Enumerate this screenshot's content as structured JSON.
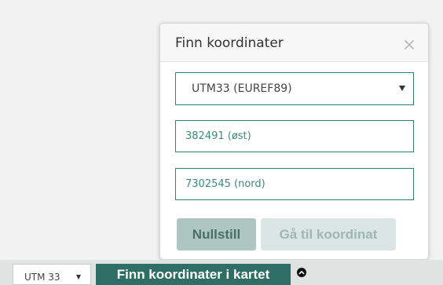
{
  "dialog": {
    "title": "Finn koordinater",
    "close_icon": "close-icon",
    "projection_select": {
      "selected": "UTM33 (EUREF89)"
    },
    "east_input": {
      "value": "",
      "placeholder": "382491 (øst)"
    },
    "north_input": {
      "value": "",
      "placeholder": "7302545 (nord)"
    },
    "reset_label": "Nullstill",
    "goto_label": "Gå til koordinat"
  },
  "bottom_bar": {
    "zone_select": {
      "selected": "UTM 33"
    },
    "find_label": "Finn koordinater i kartet",
    "collapse_icon": "chevron-up-circle-icon"
  },
  "colors": {
    "accent": "#2e6e64",
    "border_accent": "#3c7f71",
    "input_text": "#3a8a7c",
    "reset_button_bg": "#adc6c1",
    "goto_button_bg": "#dbe6e4"
  }
}
